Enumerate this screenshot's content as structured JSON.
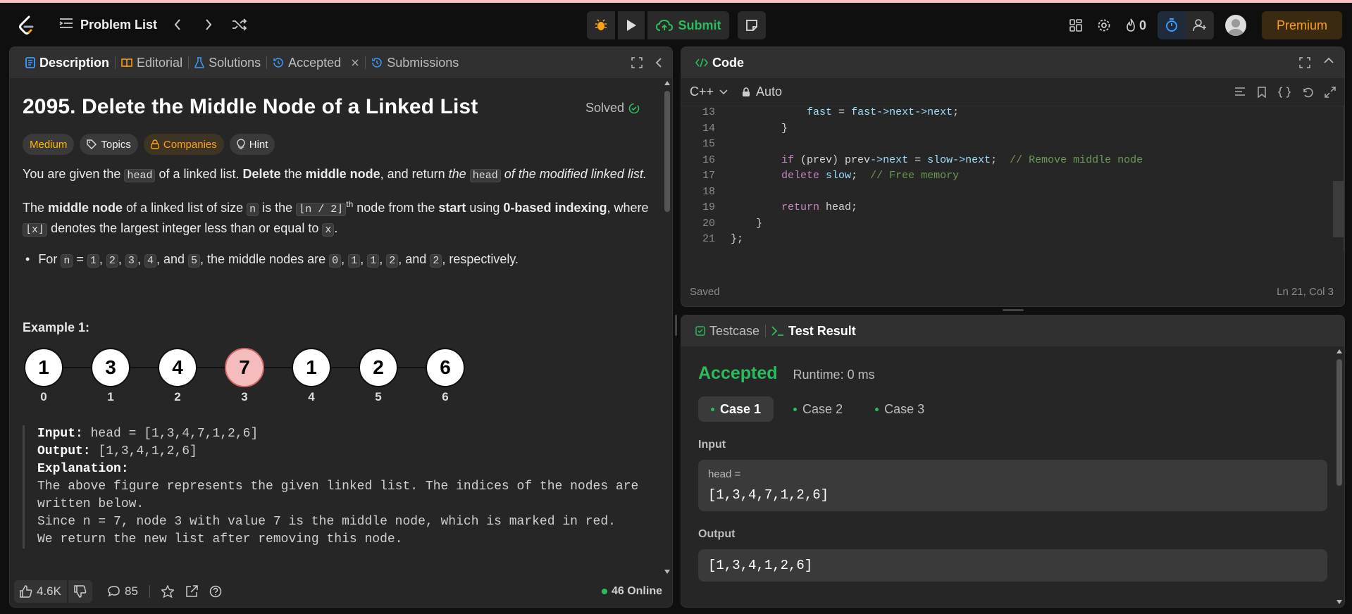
{
  "nav": {
    "problem_list": "Problem List",
    "submit": "Submit",
    "streak": "0",
    "premium": "Premium"
  },
  "left_tabs": {
    "description": "Description",
    "editorial": "Editorial",
    "solutions": "Solutions",
    "accepted": "Accepted",
    "submissions": "Submissions"
  },
  "problem": {
    "title": "2095. Delete the Middle Node of a Linked List",
    "solved": "Solved",
    "tags": {
      "difficulty": "Medium",
      "topics": "Topics",
      "companies": "Companies",
      "hint": "Hint"
    },
    "p1": {
      "a": "You are given the ",
      "b": "head",
      "c": " of a linked list. ",
      "d": "Delete",
      "e": " the ",
      "f": "middle node",
      "g": ", and return ",
      "h": "the ",
      "i": "head",
      "j": " of the modified linked list."
    },
    "p2": {
      "a": "The ",
      "b": "middle node",
      "c": " of a linked list of size ",
      "d": "n",
      "e": " is the ",
      "f": "⌊n / 2⌋",
      "g": "th",
      "h": " node from the ",
      "i": "start",
      "j": " using ",
      "k": "0-based indexing",
      "l": ", where",
      "m": "⌊x⌋",
      "n": " denotes the largest integer less than or equal to ",
      "o": "x",
      "p": "."
    },
    "bullet": {
      "a": "For ",
      "n": "n",
      "eq": " = ",
      "v1": "1",
      "c": ", ",
      "v2": "2",
      "v3": "3",
      "v4": "4",
      "and": ", and ",
      "v5": "5",
      "mid": ", the middle nodes are ",
      "r1": "0",
      "r2": "1",
      "r3": "1",
      "r4": "2",
      "r5": "2",
      "end": ", respectively."
    },
    "example_title": "Example 1:",
    "nodes": [
      "1",
      "3",
      "4",
      "7",
      "1",
      "2",
      "6"
    ],
    "indices": [
      "0",
      "1",
      "2",
      "3",
      "4",
      "5",
      "6"
    ],
    "highlighted_index": 3,
    "example": {
      "input_label": "Input:",
      "input": " head = [1,3,4,7,1,2,6]",
      "output_label": "Output:",
      "output": " [1,3,4,1,2,6]",
      "explanation_label": "Explanation:",
      "lines": [
        "The above figure represents the given linked list. The indices of the nodes are",
        "written below.",
        "Since n = 7, node 3 with value 7 is the middle node, which is marked in red.",
        "We return the new list after removing this node."
      ]
    }
  },
  "footer": {
    "likes": "4.6K",
    "comments": "85",
    "online": "46 Online"
  },
  "code_panel": {
    "title": "Code",
    "language": "C++",
    "mode": "Auto",
    "saved": "Saved",
    "cursor": "Ln 21, Col 3",
    "lines": [
      {
        "n": "13",
        "t": "            fast = fast->next->next;"
      },
      {
        "n": "14",
        "t": "        }"
      },
      {
        "n": "15",
        "t": ""
      },
      {
        "n": "16",
        "t": "        if (prev) prev->next = slow->next;  // Remove middle node"
      },
      {
        "n": "17",
        "t": "        delete slow;  // Free memory"
      },
      {
        "n": "18",
        "t": ""
      },
      {
        "n": "19",
        "t": "        return head;"
      },
      {
        "n": "20",
        "t": "    }"
      },
      {
        "n": "21",
        "t": "};"
      }
    ]
  },
  "result": {
    "tab_testcase": "Testcase",
    "tab_result": "Test Result",
    "status": "Accepted",
    "runtime": "Runtime: 0 ms",
    "cases": [
      "Case 1",
      "Case 2",
      "Case 3"
    ],
    "input_label": "Input",
    "input_var": "head =",
    "input_value": "[1,3,4,7,1,2,6]",
    "output_label": "Output",
    "output_value": "[1,3,4,1,2,6]"
  },
  "colors": {
    "accent_green": "#2cbb5d",
    "accent_orange": "#ffa116",
    "medium": "#ffb700"
  }
}
